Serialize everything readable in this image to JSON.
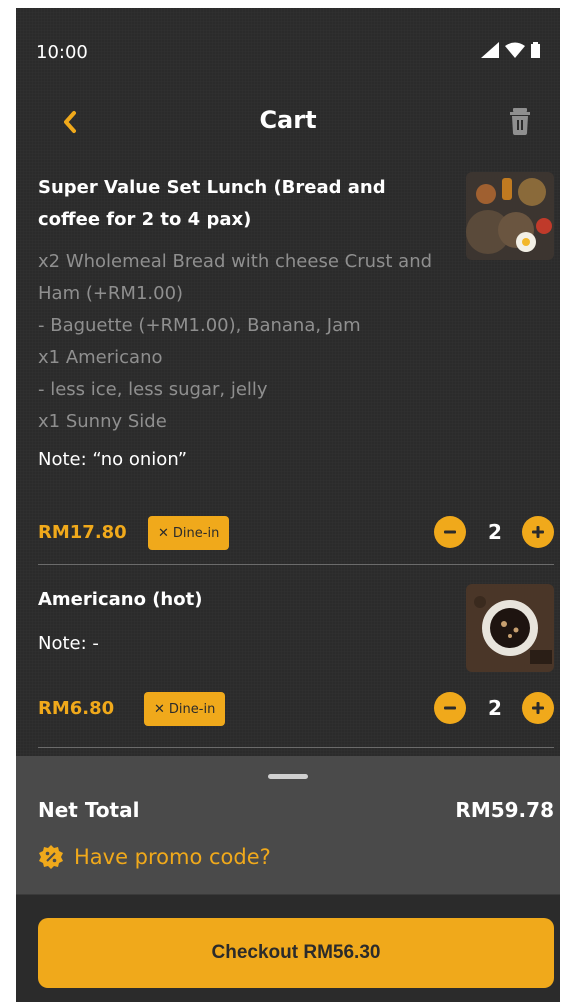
{
  "status_bar": {
    "time": "10:00"
  },
  "header": {
    "title": "Cart"
  },
  "items": [
    {
      "title": "Super Value Set Lunch (Bread and coffee for 2 to 4 pax)",
      "options": [
        "x2 Wholemeal Bread with cheese Crust and Ham (+RM1.00)",
        "- Baguette (+RM1.00), Banana, Jam",
        "x1 Americano",
        "- less ice, less sugar, jelly",
        "x1 Sunny Side"
      ],
      "note": "Note: “no onion”",
      "price": "RM17.80",
      "dine_label": "Dine-in",
      "quantity": "2"
    },
    {
      "title": "Americano (hot)",
      "options": [],
      "note": "Note: -",
      "price": "RM6.80",
      "dine_label": "Dine-in",
      "quantity": "2"
    }
  ],
  "summary": {
    "net_total_label": "Net Total",
    "net_total_value": "RM59.78",
    "promo_label": "Have promo code?"
  },
  "checkout": {
    "label": "Checkout RM56.30"
  },
  "colors": {
    "accent": "#f0a91b",
    "background": "#2b2b2b",
    "panel": "#4a4a4a"
  }
}
